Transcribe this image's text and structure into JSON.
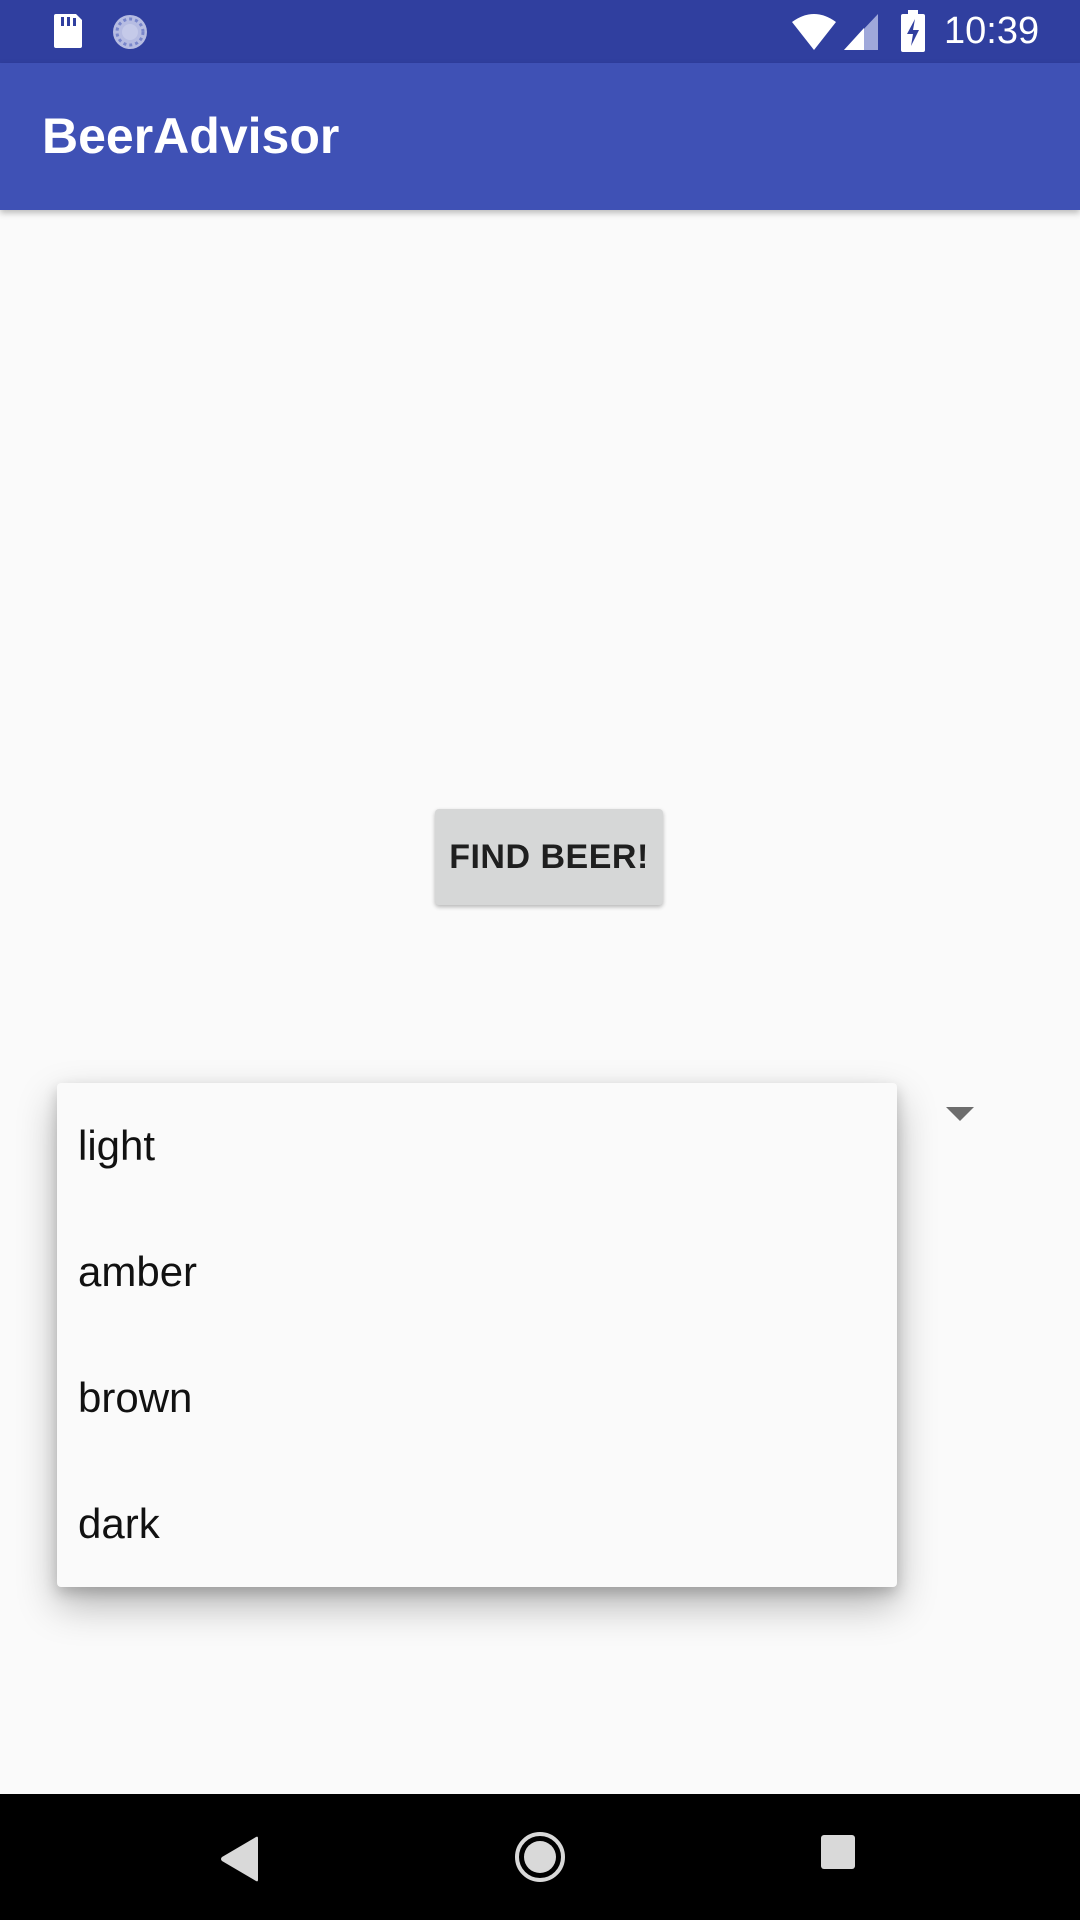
{
  "status_bar": {
    "time": "10:39",
    "icons": [
      "sd-card-icon",
      "sync-icon",
      "wifi-icon",
      "cell-signal-icon",
      "battery-charging-icon"
    ]
  },
  "app_bar": {
    "title": "BeerAdvisor"
  },
  "main": {
    "find_button_label": "FIND BEER!"
  },
  "dropdown": {
    "items": [
      "light",
      "amber",
      "brown",
      "dark"
    ]
  },
  "nav_bar": {
    "buttons": [
      "back-icon",
      "home-icon",
      "recents-icon"
    ]
  },
  "colors": {
    "status_bar": "#303f9f",
    "app_bar": "#3f51b5",
    "background": "#fafafa",
    "button": "#d6d7d7",
    "nav_bar": "#000000"
  }
}
